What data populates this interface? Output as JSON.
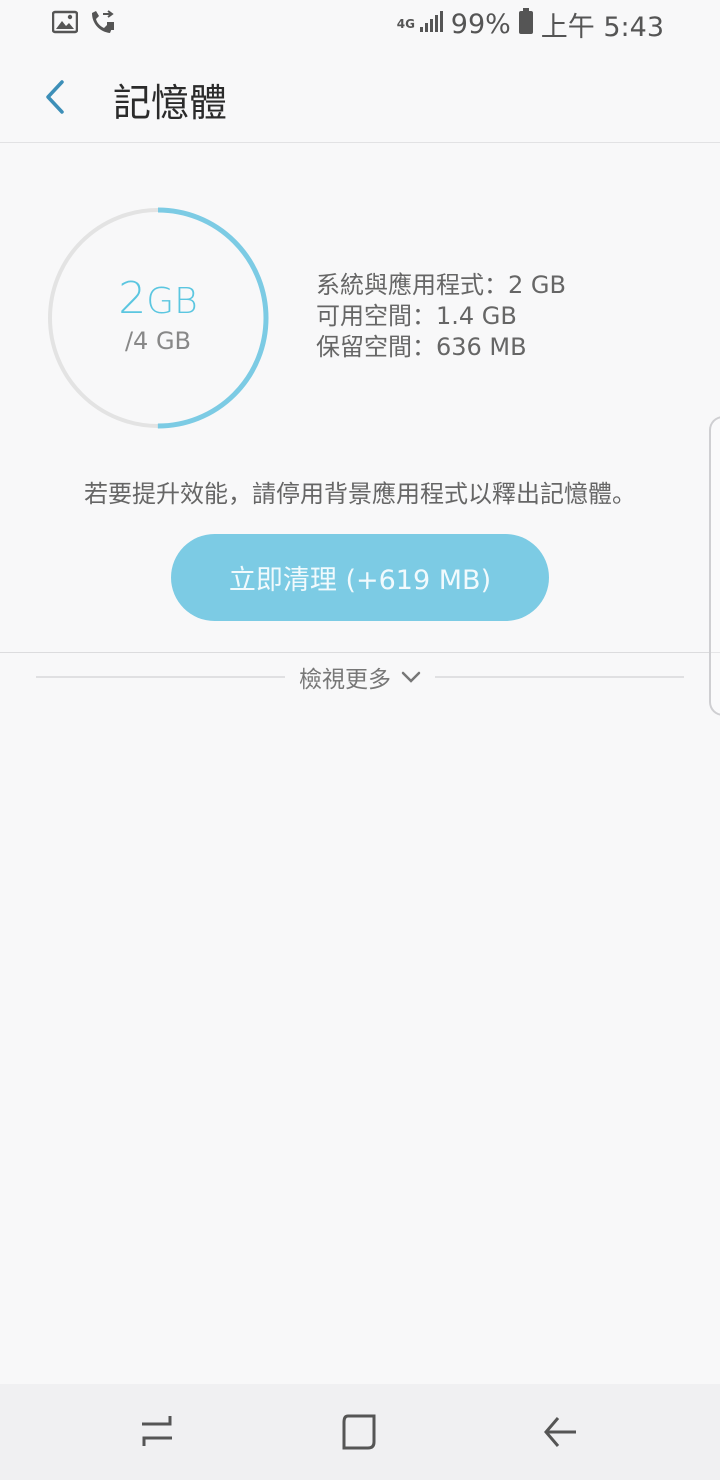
{
  "status_bar": {
    "network": "4G",
    "battery": "99%",
    "time": "上午 5:43"
  },
  "header": {
    "title": "記憶體"
  },
  "memory": {
    "used_value": "2",
    "used_unit": "GB",
    "total": "/4 GB",
    "used_fraction": 0.5,
    "info": [
      "系統與應用程式：2 GB",
      "可用空間：1.4 GB",
      "保留空間：636 MB"
    ]
  },
  "hint_text": "若要提升效能，請停用背景應用程式以釋出記憶體。",
  "clean_button": "立即清理 (+619 MB)",
  "view_more": "檢視更多",
  "colors": {
    "accent": "#5bc6e0",
    "button": "#7ccbe4",
    "track": "#e3e3e3"
  }
}
